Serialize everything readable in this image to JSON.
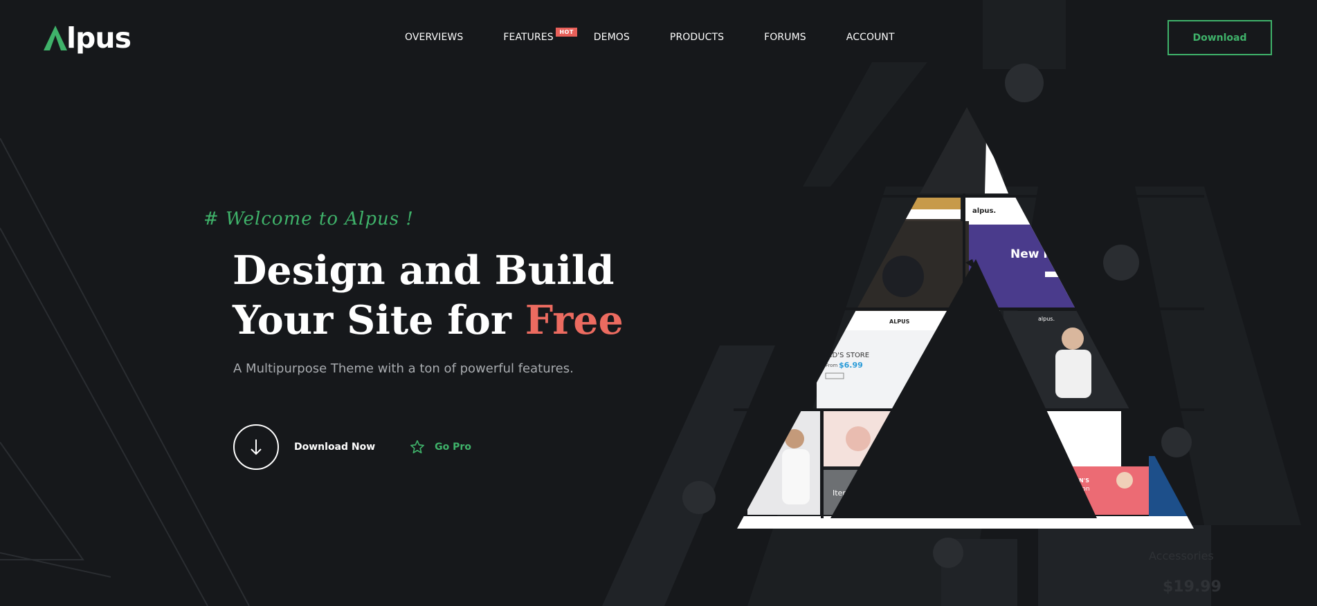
{
  "brand": {
    "name": "lpus"
  },
  "nav": {
    "items": [
      {
        "label": "OVERVIEWS"
      },
      {
        "label": "FEATURES",
        "badge": "HOT"
      },
      {
        "label": "DEMOS"
      },
      {
        "label": "PRODUCTS"
      },
      {
        "label": "FORUMS"
      },
      {
        "label": "ACCOUNT"
      }
    ]
  },
  "header": {
    "download_label": "Download"
  },
  "hero": {
    "welcome": "# Welcome to Alpus !",
    "title_line1": "Design and Build",
    "title_line2_prefix": "Your Site for ",
    "title_line2_accent": "Free",
    "subtitle": "A Multipurpose Theme with a ton of powerful features.",
    "download_now": "Download Now",
    "go_pro": "Go Pro"
  },
  "showcase": {
    "fashion_brand": "alpus.",
    "fashion_banner": "New Fashi",
    "kids_store_brand": "ALPUS",
    "kids_store_title": "KID'S STORE",
    "kids_store_from": "From",
    "kids_store_price": "$6.99",
    "man_brand": "alpus.",
    "collection_title": "WOMEN'S",
    "collection_sub": "Collection",
    "items_label": "Items",
    "background_price": "$19.99"
  },
  "colors": {
    "background": "#16181b",
    "accent_green": "#3fb26a",
    "accent_red": "#ec6b60",
    "badge_red": "#e8605a",
    "purple_banner": "#4a3b8c"
  },
  "icons": [
    "logo-triangle-icon",
    "arrow-down-icon",
    "star-outline-icon"
  ]
}
